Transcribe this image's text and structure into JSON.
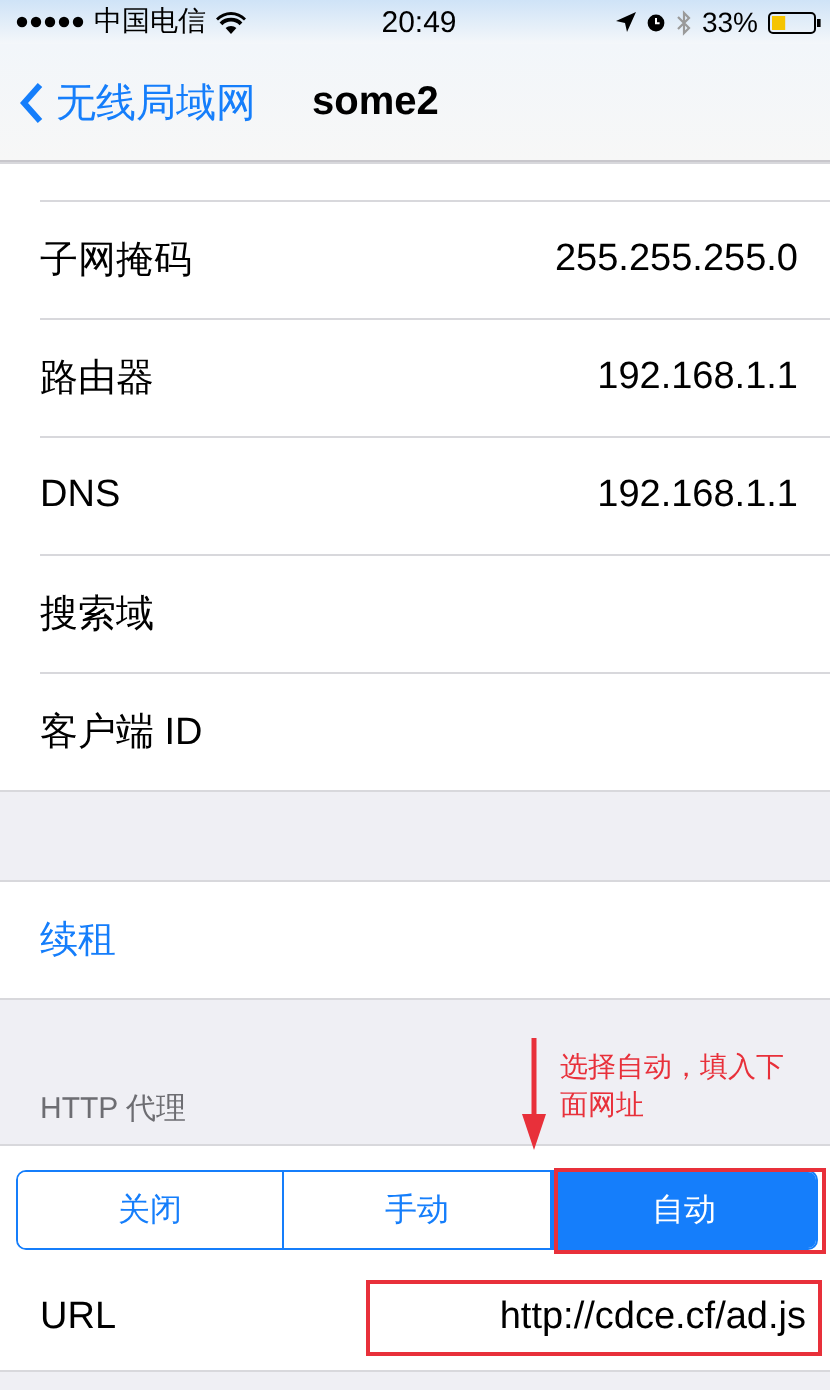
{
  "status_bar": {
    "carrier": "中国电信",
    "time": "20:49",
    "battery_text": "33%"
  },
  "nav": {
    "back": "无线局域网",
    "title": "some2"
  },
  "rows": [
    {
      "label": "子网掩码",
      "value": "255.255.255.0"
    },
    {
      "label": "路由器",
      "value": "192.168.1.1"
    },
    {
      "label": "DNS",
      "value": "192.168.1.1"
    },
    {
      "label": "搜索域"
    },
    {
      "label": "客户端 ID"
    }
  ],
  "renew": "续租",
  "proxy": {
    "header": "HTTP 代理",
    "segments": [
      {
        "label": "关闭",
        "selected": false
      },
      {
        "label": "手动",
        "selected": false
      },
      {
        "label": "自动",
        "selected": true
      }
    ],
    "url_label": "URL",
    "url_value": "http://cdce.cf/ad.js"
  },
  "annotation": {
    "text": "选择自动，填入下面网址"
  }
}
